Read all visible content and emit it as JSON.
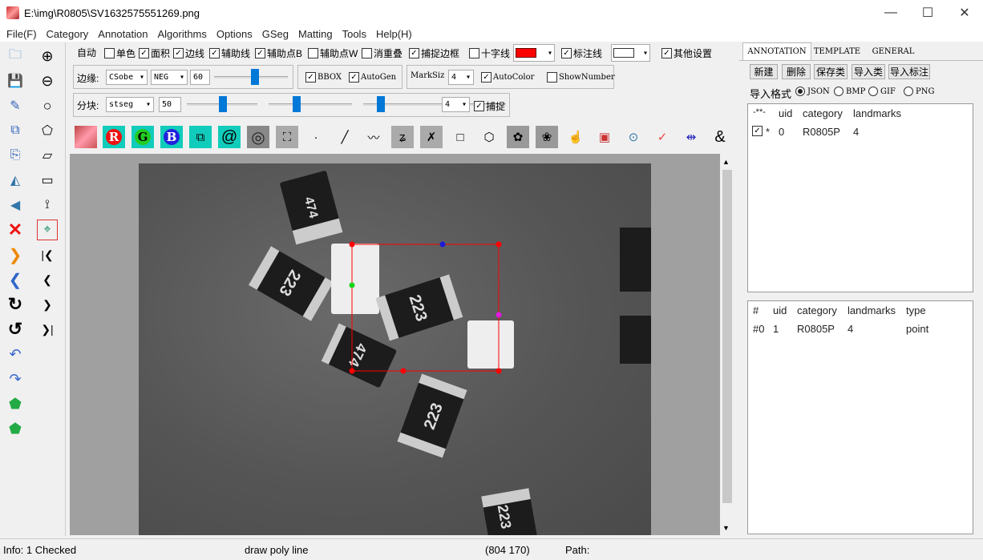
{
  "window": {
    "title": "E:\\img\\R0805\\SV1632575551269.png",
    "minimize": "—",
    "maximize": "☐",
    "close": "✕"
  },
  "menu": [
    "File(F)",
    "Category",
    "Annotation",
    "Algorithms",
    "Options",
    "GSeg",
    "Matting",
    "Tools",
    "Help(H)"
  ],
  "options_row1": {
    "auto": "自动",
    "single_color": "单色",
    "area": "面积",
    "edge": "边线",
    "aux_line": "辅助线",
    "aux_point_b": "辅助点B",
    "aux_point_w": "辅助点W",
    "remove_overlap": "消重叠",
    "snap_border": "捕捉边框",
    "crosshair": "十字线",
    "label_line": "标注线",
    "other_settings": "其他设置",
    "line_color": "#ff0000"
  },
  "options_row2": {
    "edge_label": "边缘:",
    "edge_algo": "CSobe",
    "edge_mode": "NEG",
    "edge_value": "60",
    "bbox": "BBOX",
    "autogen": "AutoGen",
    "marksize_label": "MarkSiz",
    "marksize": "4",
    "autocolor": "AutoColor",
    "shownumber": "ShowNumber"
  },
  "options_row3": {
    "block_label": "分块:",
    "block_algo": "stseg",
    "block_value": "50",
    "block_count": "4",
    "capture": "捕捉"
  },
  "iconbar": {
    "r": "R",
    "g": "G",
    "b": "B",
    "at": "@",
    "amp": "&"
  },
  "tabs": [
    "ANNOTATION",
    "TEMPLATE",
    "GENERAL"
  ],
  "right_buttons": [
    "新建",
    "删除",
    "保存类",
    "导入类",
    "导入标注"
  ],
  "import_format": {
    "label": "导入格式",
    "options": [
      "JSON",
      "BMP",
      "GIF",
      "PNG"
    ],
    "selected": "JSON"
  },
  "category_table": {
    "headers": [
      "-**-",
      "uid",
      "category",
      "landmarks"
    ],
    "rows": [
      {
        "flag": "*",
        "uid": "0",
        "category": "R0805P",
        "landmarks": "4"
      }
    ]
  },
  "landmark_table": {
    "headers": [
      "#",
      "uid",
      "category",
      "landmarks",
      "type"
    ],
    "rows": [
      {
        "idx": "#0",
        "uid": "1",
        "category": "R0805P",
        "landmarks": "4",
        "type": "point"
      }
    ]
  },
  "chips": [
    "474",
    "223",
    "223",
    "474",
    "223",
    "223"
  ],
  "status": {
    "info": "Info: 1 Checked",
    "mode": "draw poly line",
    "coords": "(804  170)",
    "path": "Path:"
  },
  "colors": {
    "accent": "#0078d7",
    "annotation": "#ff0000"
  }
}
